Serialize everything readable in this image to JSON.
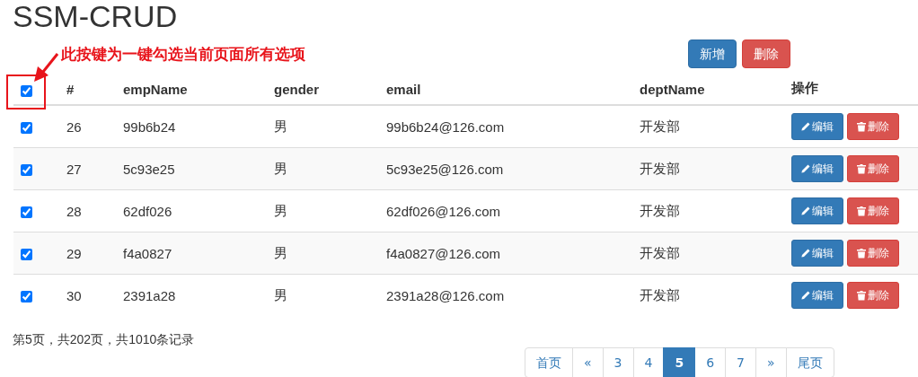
{
  "title": "SSM-CRUD",
  "annotation": {
    "text": "此按键为一键勾选当前页面所有选项"
  },
  "toolbar": [
    {
      "label": "新增",
      "kind": "primary"
    },
    {
      "label": "删除",
      "kind": "danger"
    }
  ],
  "table": {
    "select_all": {
      "checked": true
    },
    "columns": [
      "#",
      "empName",
      "gender",
      "email",
      "deptName",
      "操作"
    ],
    "rows": [
      {
        "checked": true,
        "id": "26",
        "empName": "99b6b24",
        "gender": "男",
        "email": "99b6b24@126.com",
        "deptName": "开发部",
        "edit": "编辑",
        "delete": "删除"
      },
      {
        "checked": true,
        "id": "27",
        "empName": "5c93e25",
        "gender": "男",
        "email": "5c93e25@126.com",
        "deptName": "开发部",
        "edit": "编辑",
        "delete": "删除"
      },
      {
        "checked": true,
        "id": "28",
        "empName": "62df026",
        "gender": "男",
        "email": "62df026@126.com",
        "deptName": "开发部",
        "edit": "编辑",
        "delete": "删除"
      },
      {
        "checked": true,
        "id": "29",
        "empName": "f4a0827",
        "gender": "男",
        "email": "f4a0827@126.com",
        "deptName": "开发部",
        "edit": "编辑",
        "delete": "删除"
      },
      {
        "checked": true,
        "id": "30",
        "empName": "2391a28",
        "gender": "男",
        "email": "2391a28@126.com",
        "deptName": "开发部",
        "edit": "编辑",
        "delete": "删除"
      }
    ]
  },
  "page_info": "第5页，共202页，共1010条记录",
  "pagination": [
    {
      "label": "首页",
      "selected": false
    },
    {
      "label": "«",
      "selected": false
    },
    {
      "label": "3",
      "selected": false
    },
    {
      "label": "4",
      "selected": false
    },
    {
      "label": "5",
      "selected": true
    },
    {
      "label": "6",
      "selected": false
    },
    {
      "label": "7",
      "selected": false
    },
    {
      "label": "»",
      "selected": false
    },
    {
      "label": "尾页",
      "selected": false
    }
  ]
}
